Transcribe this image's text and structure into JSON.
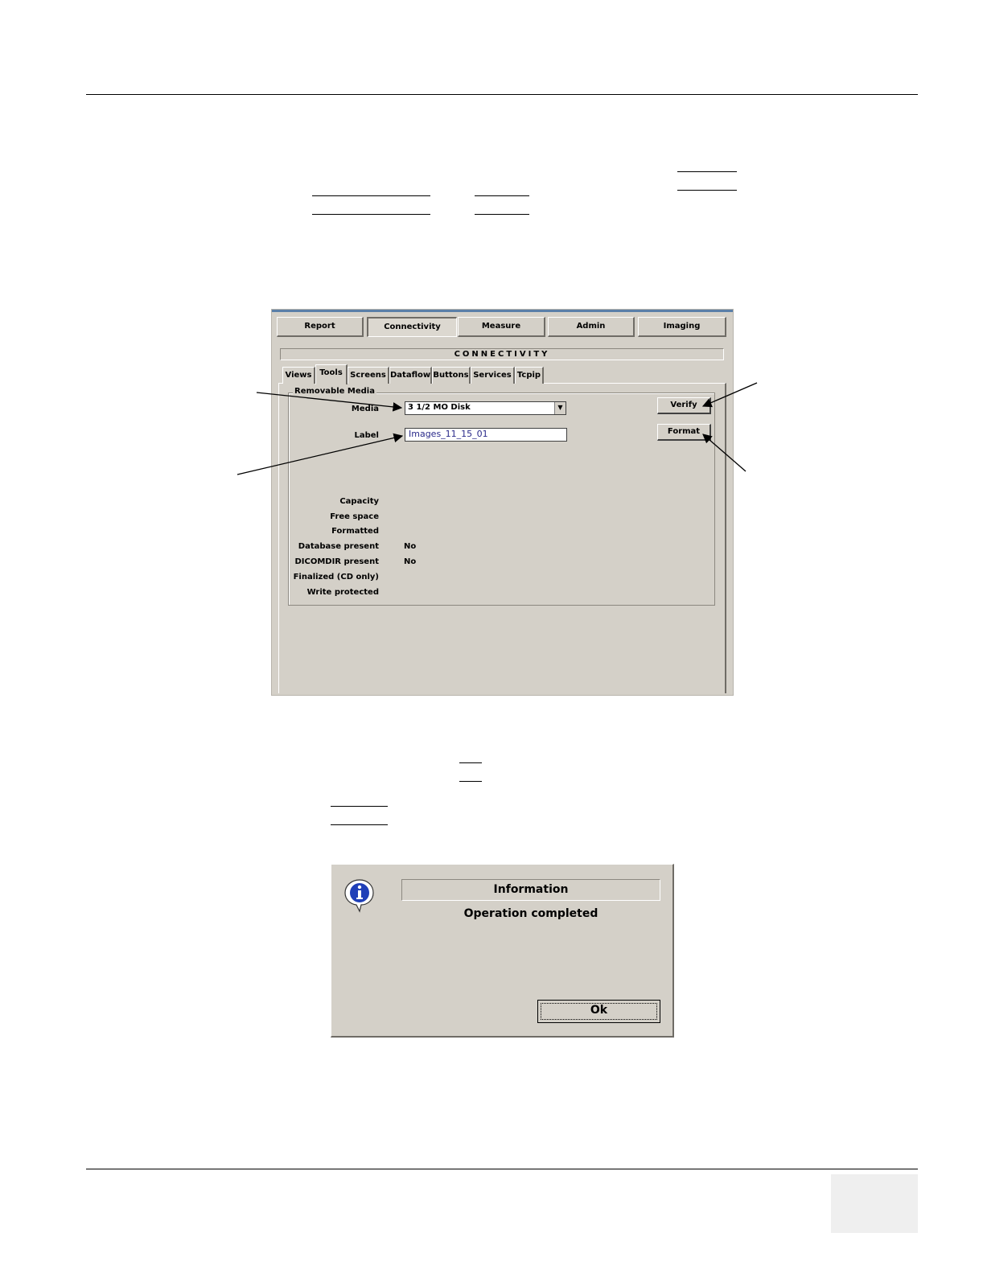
{
  "main_tabs": [
    {
      "label": "Report"
    },
    {
      "label": "Connectivity"
    },
    {
      "label": "Measure"
    },
    {
      "label": "Admin"
    },
    {
      "label": "Imaging"
    }
  ],
  "section_title": "CONNECTIVITY",
  "sub_tabs": [
    {
      "label": "Views"
    },
    {
      "label": "Tools"
    },
    {
      "label": "Screens"
    },
    {
      "label": "Dataflow"
    },
    {
      "label": "Buttons"
    },
    {
      "label": "Services"
    },
    {
      "label": "Tcpip"
    }
  ],
  "removable_media": {
    "group_label": "Removable Media",
    "media_label": "Media",
    "media_value": "3 1/2 MO Disk",
    "label_label": "Label",
    "label_value": "Images_11_15_01",
    "verify_button": "Verify",
    "format_button": "Format",
    "properties": [
      {
        "label": "Capacity",
        "value": ""
      },
      {
        "label": "Free space",
        "value": ""
      },
      {
        "label": "Formatted",
        "value": ""
      },
      {
        "label": "Database present",
        "value": "No"
      },
      {
        "label": "DICOMDIR present",
        "value": "No"
      },
      {
        "label": "Finalized (CD only)",
        "value": ""
      },
      {
        "label": "Write protected",
        "value": ""
      }
    ]
  },
  "info_dialog": {
    "icon": "info-icon",
    "title": "Information",
    "message": "Operation completed",
    "ok_button": "Ok"
  }
}
